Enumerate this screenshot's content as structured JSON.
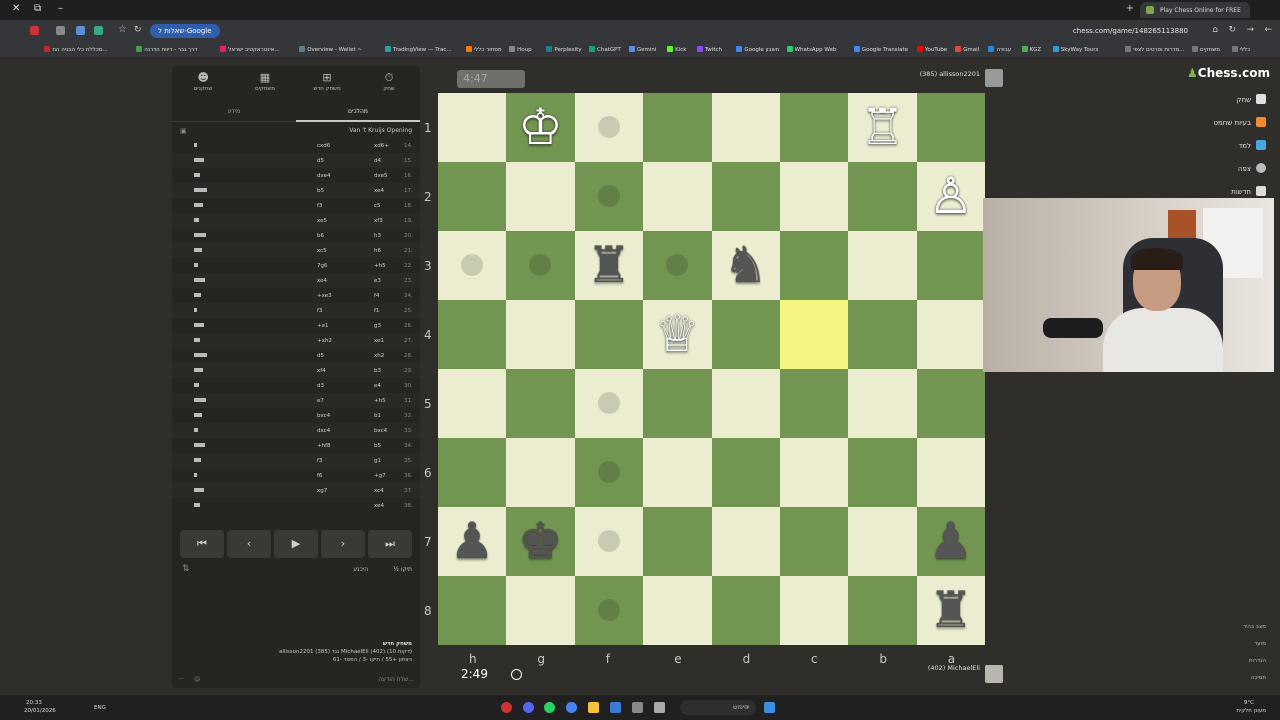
{
  "browser": {
    "tab_title": "Play Chess Online for FREE",
    "url": "chess.com/game/148265113880",
    "google_chip": "שאלות ל-Google",
    "bookmarks": [
      "כללי",
      "משחקים",
      "סדרות וסרטים לצפי...",
      "SkyWay Tours",
      "KGZ",
      "עבודה",
      "Gmail",
      "YouTube",
      "Google Translate",
      "WhatsApp Web",
      "Google חשבון",
      "Twitch",
      "Kick",
      "Gemini",
      "ChatGPT",
      "Perplexity",
      "Houp",
      "מסתור כללי",
      "TradingView — Trac...",
      "Overview - Wallet ~",
      "אינטראקטיב ישראל...",
      "דרך גבר - דיווח הדרגה",
      "מכללת כלי הבניה הח..."
    ]
  },
  "panel": {
    "tabs": [
      "שחק",
      "משחק חדש",
      "משחקים",
      "שחקנים"
    ],
    "subtabs": [
      "מהלכים",
      "מידע"
    ],
    "opening": "Van 't Kruijs Opening",
    "moves": [
      {
        "num": "14.",
        "white": "xd6+",
        "black": "cxd6"
      },
      {
        "num": "15.",
        "white": "d4",
        "black": "d5"
      },
      {
        "num": "16.",
        "white": "dxe5",
        "black": "dxe4"
      },
      {
        "num": "17.",
        "white": "xe4",
        "black": "b5"
      },
      {
        "num": "18.",
        "white": "c5",
        "black": "f3"
      },
      {
        "num": "19.",
        "white": "xf3",
        "black": "xe5"
      },
      {
        "num": "20.",
        "white": "h3",
        "black": "b6"
      },
      {
        "num": "21.",
        "white": "h6",
        "black": "xc5"
      },
      {
        "num": "22.",
        "white": "+h5",
        "black": "7g6"
      },
      {
        "num": "23.",
        "white": "e3",
        "black": "xe4"
      },
      {
        "num": "24.",
        "white": "f4",
        "black": "+xe3"
      },
      {
        "num": "25.",
        "white": "f1",
        "black": "f3"
      },
      {
        "num": "26.",
        "white": "g3",
        "black": "+e1"
      },
      {
        "num": "27.",
        "white": "xe1",
        "black": "+xh2"
      },
      {
        "num": "28.",
        "white": "xh2",
        "black": "d5"
      },
      {
        "num": "29.",
        "white": "b3",
        "black": "xf4"
      },
      {
        "num": "30.",
        "white": "e4",
        "black": "d3"
      },
      {
        "num": "31.",
        "white": "+h5",
        "black": "e7"
      },
      {
        "num": "32.",
        "white": "b1",
        "black": "bxc4"
      },
      {
        "num": "33.",
        "white": "bxc4",
        "black": "dxc4"
      },
      {
        "num": "34.",
        "white": "b5",
        "black": "+hf8"
      },
      {
        "num": "35.",
        "white": "g1",
        "black": "f3"
      },
      {
        "num": "36.",
        "white": "+g7",
        "black": "f6"
      },
      {
        "num": "37.",
        "white": "xc4",
        "black": "xg7"
      },
      {
        "num": "38.",
        "white": "xe4",
        "black": ""
      }
    ],
    "nav": [
      "⏮",
      "‹",
      "▶",
      "›",
      "⏭"
    ],
    "actions": {
      "draw": "½ תיקו",
      "resign": "היכנע"
    },
    "new_game_title": "משחק חדש",
    "new_game_line1": "allisson2201 (385) נגד MichaelEli (402) (10 דקות)",
    "new_game_line2": "ניצחון +55 / תיקו -3 / הפסד -61",
    "chat_placeholder": "שלח הודעה..."
  },
  "board": {
    "top_clock": "4:47",
    "top_player": "allisson2201",
    "top_rating": "(385)",
    "bottom_clock": "2:49",
    "bottom_player": "MichaelEli",
    "bottom_rating": "(402)",
    "ranks": [
      "1",
      "2",
      "3",
      "4",
      "5",
      "6",
      "7",
      "8"
    ],
    "files": [
      "h",
      "g",
      "f",
      "e",
      "d",
      "c",
      "b",
      "a"
    ]
  },
  "sidenav": {
    "logo": "Chess.com",
    "items": [
      "שחק",
      "בעיות שחמט",
      "למד",
      "צפה",
      "חדשות"
    ],
    "bottom": [
      "מצב בהיר",
      "מוער",
      "הגדרות",
      "תמיכה"
    ]
  },
  "taskbar": {
    "search": "חיפוש",
    "time": "20:33",
    "date": "20/01/2026",
    "lang": "ENG",
    "weather": "9°C",
    "weather_desc": "מעונן חלקית"
  }
}
